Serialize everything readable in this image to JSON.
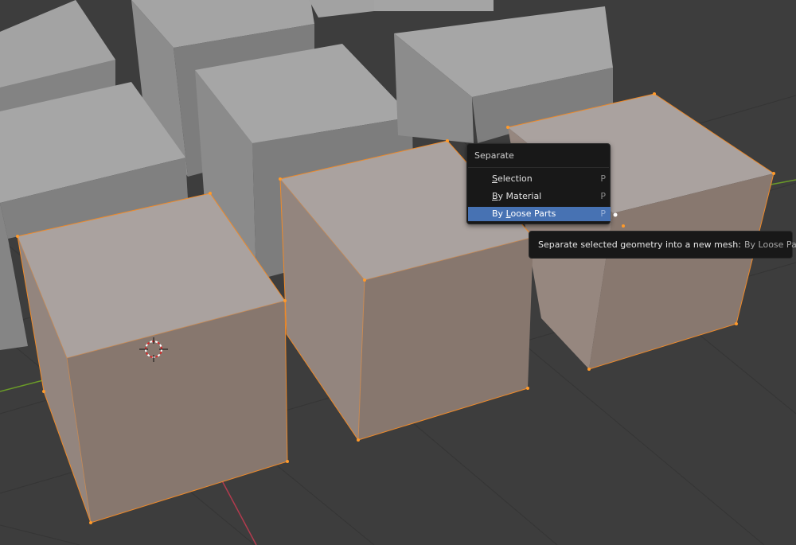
{
  "viewport": {
    "name": "3D Viewport"
  },
  "menu": {
    "title": "Separate",
    "items": [
      {
        "label_pre": "",
        "label_key": "S",
        "label_post": "election",
        "shortcut": "P",
        "active": false
      },
      {
        "label_pre": "",
        "label_key": "B",
        "label_post": "y Material",
        "shortcut": "P",
        "active": false
      },
      {
        "label_pre": "By ",
        "label_key": "L",
        "label_post": "oose Parts",
        "shortcut": "P",
        "active": true
      }
    ]
  },
  "tooltip": {
    "text": "Separate selected geometry into a new mesh:",
    "operator": "By Loose Parts"
  },
  "colors": {
    "background": "#3d3d3d",
    "grid": "#343434",
    "cube_top": "#9e9e9e",
    "cube_left": "#858585",
    "cube_right": "#7a7a7a",
    "selected_top": "#a8a09d",
    "selected_left": "#93857e",
    "selected_right": "#87776e",
    "edge_selected": "#ef8a29",
    "axis_x": "#b33b4e",
    "axis_y": "#6a9a28",
    "menu_highlight": "#4772b3"
  }
}
